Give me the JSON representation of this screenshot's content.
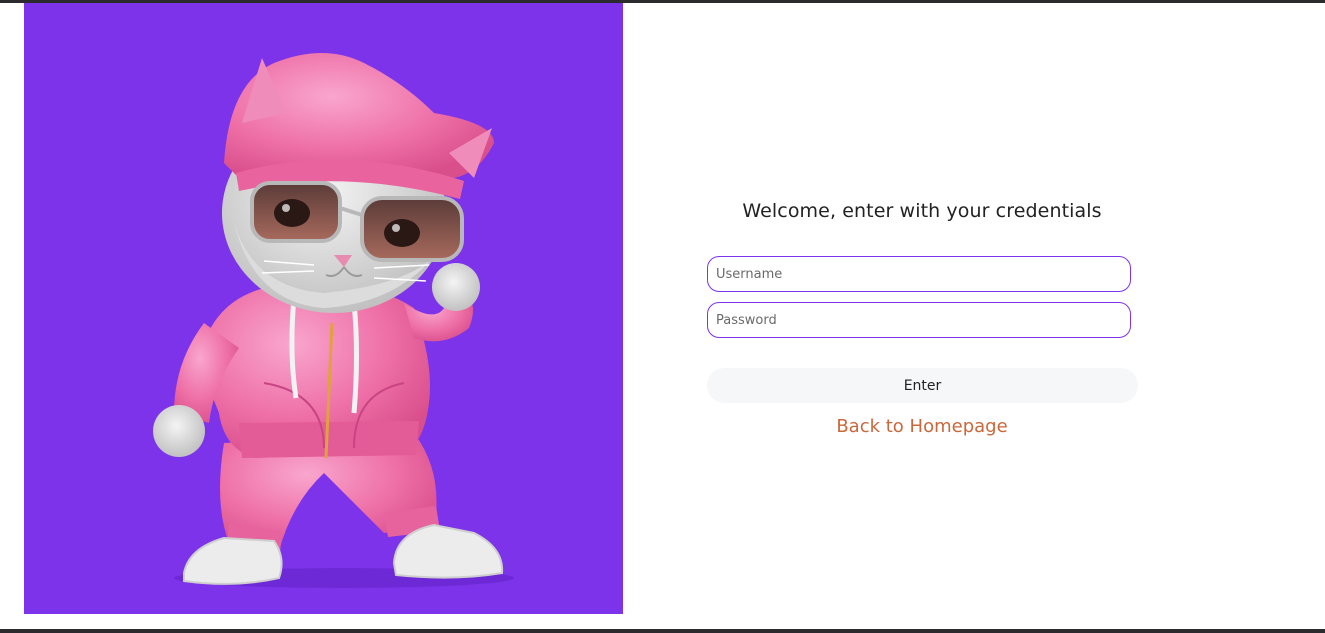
{
  "login": {
    "welcome_text": "Welcome, enter with your credentials",
    "username_placeholder": "Username",
    "username_value": "",
    "password_placeholder": "Password",
    "password_value": "",
    "enter_label": "Enter",
    "back_link_label": "Back to Homepage"
  },
  "colors": {
    "hero_background": "#7c33ea",
    "accent": "#7c33ea",
    "link": "#c9683c",
    "button_background": "#f6f7f9",
    "frame_bar": "#2b2b2f"
  },
  "hero": {
    "image": "cat-character-illustration"
  }
}
